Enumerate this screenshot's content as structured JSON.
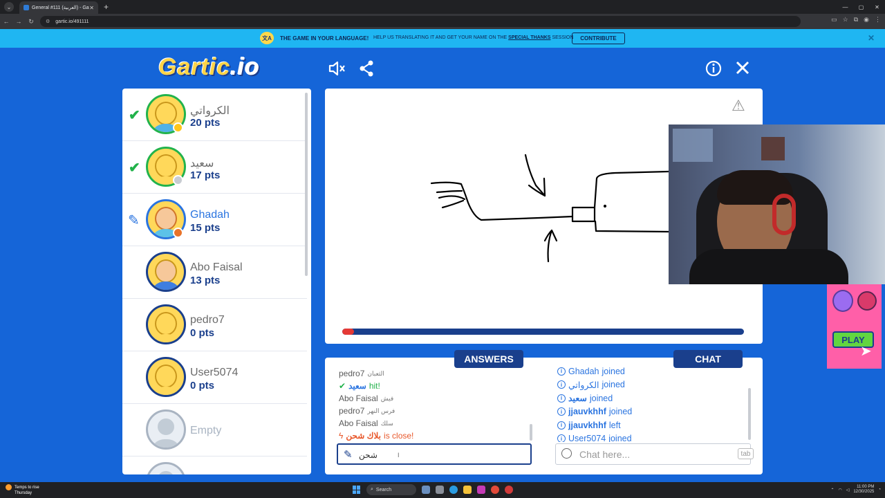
{
  "browser": {
    "tab_title": "General #111 (العربية) - Gartic.io",
    "url": "gartic.io/491111"
  },
  "banner": {
    "headline": "THE GAME IN YOUR LANGUAGE!",
    "text": "HELP US TRANSLATING IT AND GET YOUR NAME ON THE",
    "link": "SPECIAL THANKS",
    "text2": "SESSION",
    "button": "CONTRIBUTE"
  },
  "logo": {
    "main": "Gartic",
    "suffix": ".io"
  },
  "players": [
    {
      "name": "الكرواتي",
      "points": "20 pts",
      "status": "check",
      "dot": "#ffc61a"
    },
    {
      "name": "سعيد",
      "points": "17 pts",
      "status": "check",
      "dot": "#c8ccd2"
    },
    {
      "name": "Ghadah",
      "points": "15 pts",
      "status": "drawing",
      "dot": "#e8732a"
    },
    {
      "name": "Abo Faisal",
      "points": "13 pts",
      "status": "none",
      "dot": ""
    },
    {
      "name": "pedro7",
      "points": "0 pts",
      "status": "none",
      "dot": ""
    },
    {
      "name": "User5074",
      "points": "0 pts",
      "status": "none",
      "dot": ""
    },
    {
      "name": "Empty",
      "points": "",
      "status": "empty",
      "dot": ""
    }
  ],
  "canvas": {
    "progress_fraction": 0.03
  },
  "ad": {
    "play_label": "PLAY"
  },
  "answers": {
    "header": "ANSWERS",
    "lines": [
      {
        "name": "pedro7",
        "msg": "الثعبان",
        "kind": "guess"
      },
      {
        "name": "سعيد",
        "msg": "hit!",
        "kind": "hit"
      },
      {
        "name": "Abo Faisal",
        "msg": "فيش",
        "kind": "guess"
      },
      {
        "name": "pedro7",
        "msg": "فرس النهر",
        "kind": "guess"
      },
      {
        "name": "Abo Faisal",
        "msg": "سلك",
        "kind": "guess"
      },
      {
        "name": "بلاك شحن",
        "msg": "is close!",
        "kind": "close"
      }
    ],
    "input_value": "شحن"
  },
  "chat": {
    "header": "CHAT",
    "lines": [
      {
        "name": "Ghadah",
        "action": "joined",
        "bold": false
      },
      {
        "name": "الكرواتي",
        "action": "joined",
        "bold": false
      },
      {
        "name": "سعيد",
        "action": "joined",
        "bold": true
      },
      {
        "name": "jjauvkhhf",
        "action": "joined",
        "bold": true
      },
      {
        "name": "jjauvkhhf",
        "action": "left",
        "bold": true
      },
      {
        "name": "User5074",
        "action": "joined",
        "bold": false
      }
    ],
    "placeholder": "Chat here...",
    "tab_hint": "tab"
  },
  "taskbar": {
    "weather_title": "Temps to rise",
    "weather_sub": "Thursday",
    "search": "Search",
    "time": "11:00 PM",
    "date": "12/30/2025"
  }
}
